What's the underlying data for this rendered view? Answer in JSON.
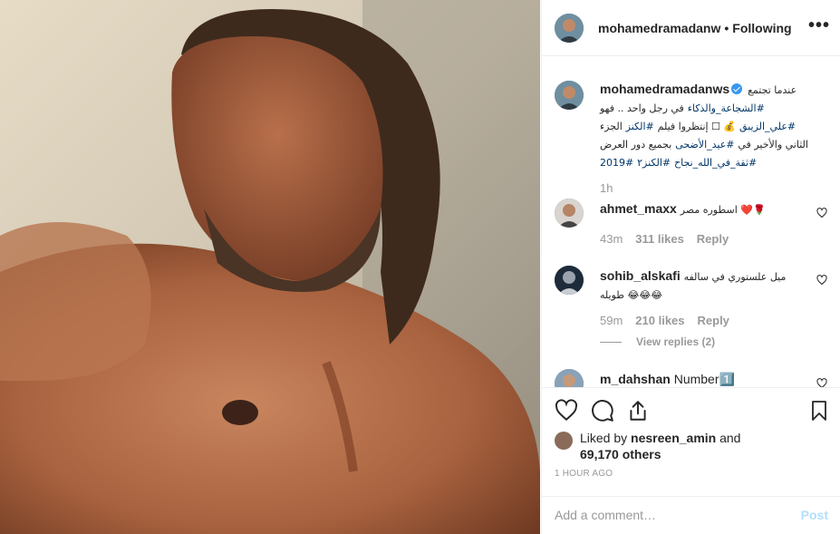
{
  "post": {
    "image_alt": "photo",
    "header": {
      "username": "mohamedramadanw",
      "separator": "•",
      "follow_status": "Following",
      "more_icon": "more-options-icon",
      "more_glyph": "•••"
    },
    "caption": {
      "username": "mohamedramadanws",
      "text_lead": "عندما تجتمع",
      "tag1": "#الشجاعة_والذكاء",
      "text_a": "في رجل واحد .. فهو",
      "tag2": "#علي_الزيبق",
      "text_b": "💰 ☐ إنتظروا فيلم",
      "tag3": "#الكنز",
      "text_c": "الجزء الثاني والأخير في",
      "tag4": "#عيد_الأضحى",
      "text_d": "بجميع دور العرض",
      "tag5": "#ثقة_في_الله_نجاح",
      "tag6": "#الكنز٢",
      "tag7": "#2019",
      "time": "1h"
    },
    "comments": [
      {
        "username": "ahmet_maxx",
        "text": "اسطوره مصر ❤️🌹",
        "time": "43m",
        "likes": "311 likes",
        "reply": "Reply"
      },
      {
        "username": "sohib_alskafi",
        "text": "ميل علستوري في سالفه طويله 😂😂😂",
        "time": "59m",
        "likes": "210 likes",
        "reply": "Reply",
        "view_replies": "View replies (2)"
      },
      {
        "username": "m_dahshan",
        "text": "Number1️⃣"
      }
    ],
    "likes": {
      "prefix": "Liked by",
      "user": "nesreen_amin",
      "and": "and",
      "others": "69,170 others"
    },
    "timestamp": "1 HOUR AGO",
    "add_comment": {
      "placeholder": "Add a comment…",
      "post_label": "Post"
    }
  },
  "colors": {
    "link": "#003569",
    "verified": "#3897f0",
    "muted": "#999999",
    "post_disabled": "#b2dffc"
  }
}
